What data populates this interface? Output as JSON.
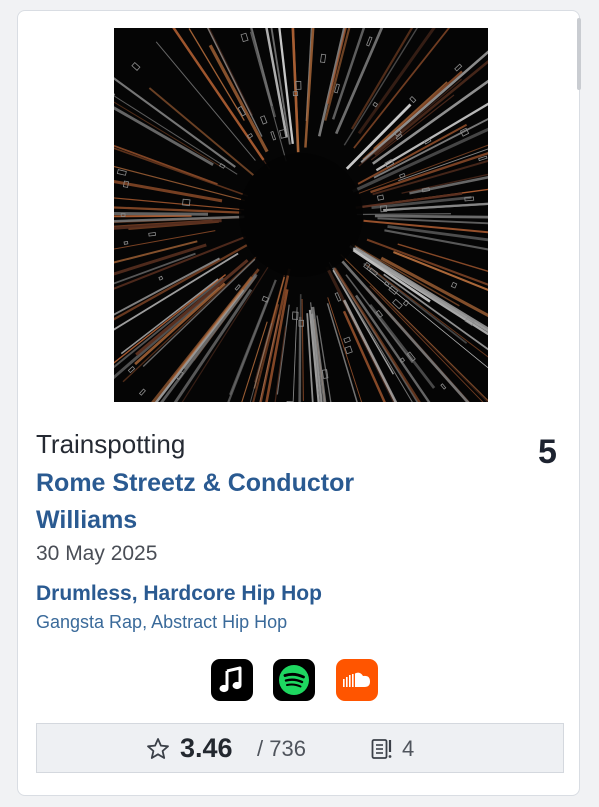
{
  "album": {
    "title": "Trainspotting",
    "rank": "5",
    "artist": "Rome Streetz & Conductor Williams",
    "release_date": "30 May 2025",
    "primary_genres": "Drumless, Hardcore Hip Hop",
    "secondary_genres": "Gangsta Rap, Abstract Hip Hop",
    "cover_icon": "album-cover-art"
  },
  "services": [
    {
      "name": "Apple Music",
      "icon": "apple-music-icon",
      "color": "#000000"
    },
    {
      "name": "Spotify",
      "icon": "spotify-icon",
      "color": "#000000"
    },
    {
      "name": "SoundCloud",
      "icon": "soundcloud-icon",
      "color": "#ff5500"
    }
  ],
  "stats": {
    "rating": "3.46",
    "ratings_count": "/ 736",
    "review_count": "4",
    "star_icon": "star-outline-icon",
    "reviews_icon": "review-document-icon"
  },
  "colors": {
    "link_blue": "#2a5a91",
    "text_dark": "#252a33",
    "stats_bg": "#eef0f3"
  }
}
